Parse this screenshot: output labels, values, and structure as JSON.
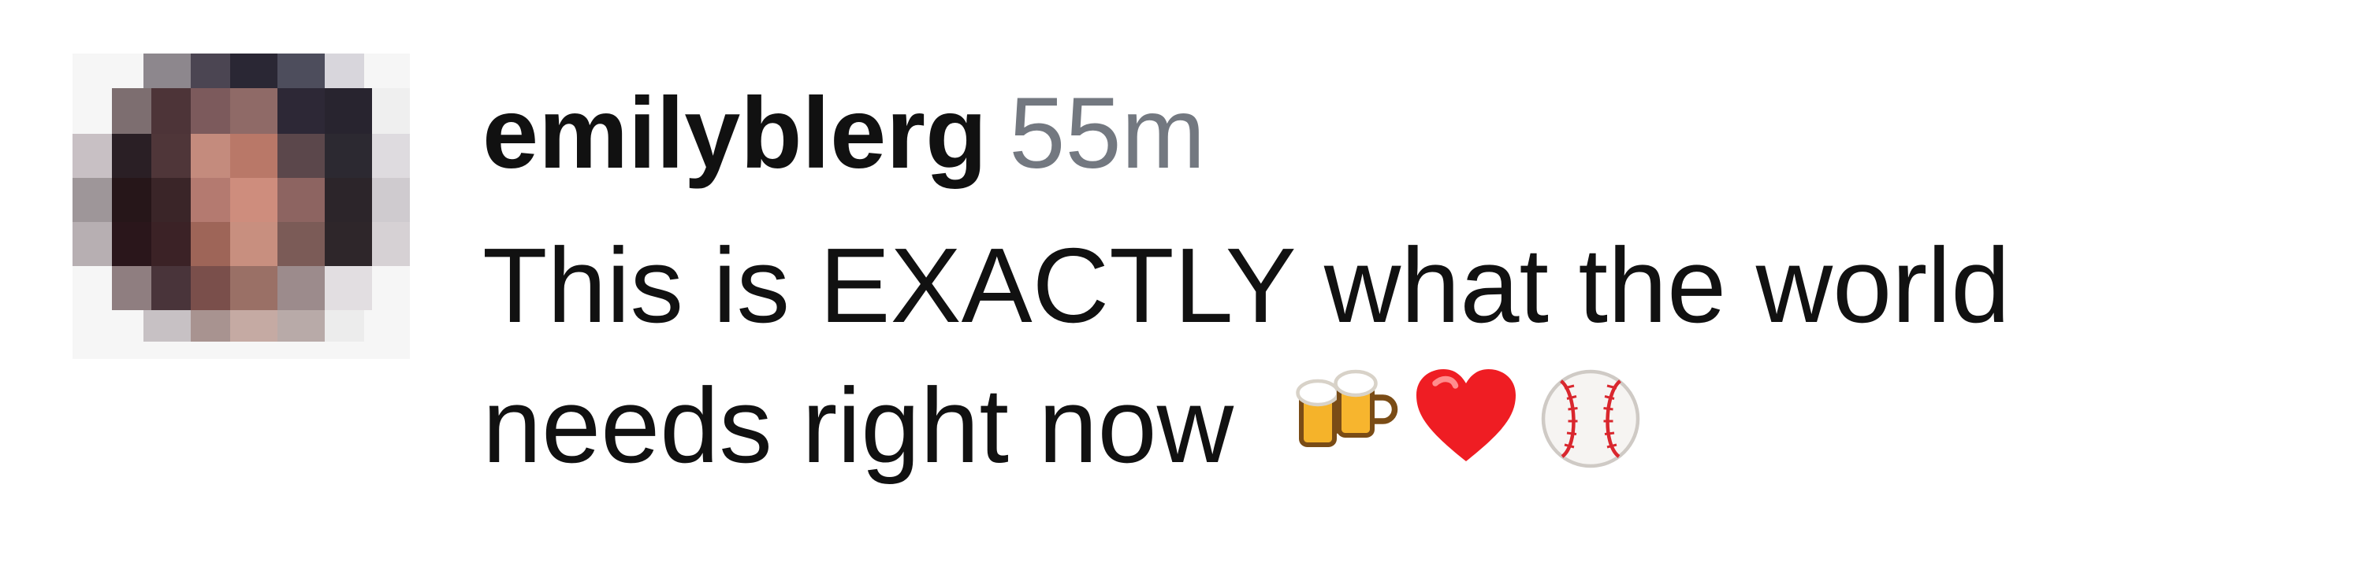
{
  "comment": {
    "username": "emilyblerg",
    "timestamp": "55m",
    "text_line_1": "This is EXACTLY what the world",
    "text_line_2": "needs right now",
    "emoji": [
      "beer-mugs-icon",
      "red-heart-icon",
      "baseball-icon"
    ]
  }
}
